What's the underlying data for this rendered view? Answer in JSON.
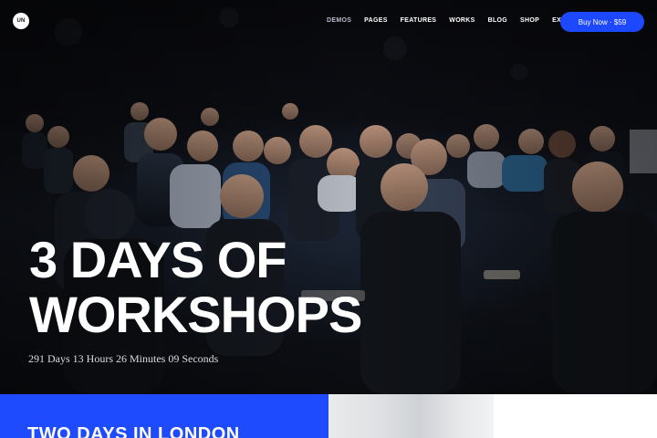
{
  "header": {
    "logo_text": "UN",
    "nav": [
      {
        "label": "DEMOS",
        "active": true
      },
      {
        "label": "PAGES"
      },
      {
        "label": "FEATURES"
      },
      {
        "label": "WORKS"
      },
      {
        "label": "BLOG"
      },
      {
        "label": "SHOP"
      },
      {
        "label": "EXTRA"
      }
    ],
    "cta_label": "Buy Now · $59"
  },
  "hero": {
    "title_line1": "3 DAYS OF",
    "title_line2": "WORKSHOPS",
    "countdown": "291 Days 13 Hours 26 Minutes 09 Seconds"
  },
  "section": {
    "title": "TWO DAYS IN LONDON"
  },
  "colors": {
    "accent": "#1f4bff",
    "hero_bg": "#0d0f15",
    "text": "#ffffff"
  },
  "icons": {
    "logo": "logo-icon"
  }
}
